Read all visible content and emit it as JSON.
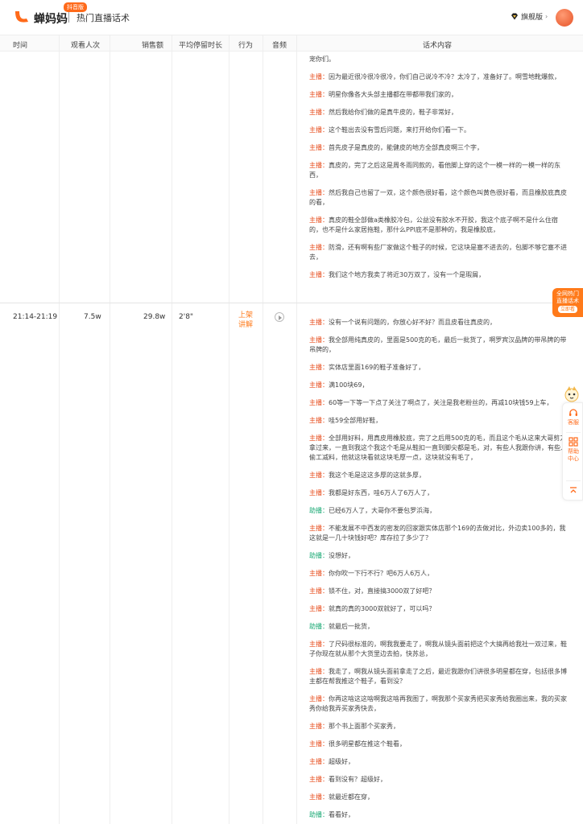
{
  "header": {
    "brand": "蝉妈妈",
    "badge": "抖音版",
    "product_title": "热门直播话术",
    "vip_label": "旗舰版",
    "vip_arrow": "›"
  },
  "columns": [
    "时间",
    "观看人次",
    "销售额",
    "平均停留时长",
    "行为",
    "音频",
    "话术内容"
  ],
  "speakers": {
    "host": "主播：",
    "assistant": "助播："
  },
  "colors": {
    "brand": "#ff6a1a",
    "host": "#e74c1c",
    "assistant": "#19a974"
  },
  "rows": [
    {
      "time": "",
      "viewers": "",
      "sales": "",
      "avg_stay": "",
      "action": "",
      "lines": [
        {
          "speaker": "",
          "text": "宠你们。"
        },
        {
          "speaker": "host",
          "text": "因为最近很冷很冷很冷，你们自己说冷不冷？太冷了，准备好了。啊雪地靴爆款，"
        },
        {
          "speaker": "host",
          "text": "明星你像各大头部主播都在带都带我们家的，"
        },
        {
          "speaker": "host",
          "text": "然后我给你们做的是真牛皮的，鞋子非常好，"
        },
        {
          "speaker": "host",
          "text": "这个鞋出去没有雪后问题，来打开给你们看一下。"
        },
        {
          "speaker": "host",
          "text": "首先皮子是真皮的，能健皮的地方全部真皮啊三个字，"
        },
        {
          "speaker": "host",
          "text": "真皮的，完了之后这是周冬雨同款的，看他脚上穿的这个一模一样的一模一样的东西，"
        },
        {
          "speaker": "host",
          "text": "然后我自己也留了一双，这个颜色很好看，这个颜色叫黄色很好看，而且橡胶底真皮的看，"
        },
        {
          "speaker": "host",
          "text": "真皮的鞋全部做a类橡胶冷包，公益没有胶水不开胶，我这个底子啊不是什么住宿的，也不是什么家居拖鞋，那什么PPI底不是那种的，我是橡胶底，"
        },
        {
          "speaker": "host",
          "text": "防滑，还有啊有些厂家做这个鞋子的时候，它这块是塞不进去的，包脚不够它塞不进去，"
        },
        {
          "speaker": "host",
          "text": "我们这个地方我卖了将近30万双了，没有一个是瑕屑，"
        }
      ]
    },
    {
      "time": "21:14-21:19",
      "viewers": "7.5w",
      "sales": "29.8w",
      "avg_stay": "2'8\"",
      "action": "上架讲解",
      "lines": [
        {
          "speaker": "host",
          "text": "没有一个说有问题的，你放心好不好？而且皮看往真皮的，"
        },
        {
          "speaker": "host",
          "text": "我全部用纯真皮的，里面是500克的毛，最后一批货了，啊罗宾汉品牌的带吊牌的带吊牌的，"
        },
        {
          "speaker": "host",
          "text": "实体店里面169的鞋子准备好了，"
        },
        {
          "speaker": "host",
          "text": "满100块69，"
        },
        {
          "speaker": "host",
          "text": "60等一下等一下点了关注了啊点了，关注是我老粉丝的，再减10块钱59上车，"
        },
        {
          "speaker": "host",
          "text": "哇59全部用好鞋，"
        },
        {
          "speaker": "host",
          "text": "全部用好料，用真皮用橡胶底，完了之后用500克的毛，而且这个毛从这来大哥剪刀拿过来，一直到我这个我这个毛是从鞋扣一直到脚尖都是毛，对，有些人我跟你讲，有些人偷工减料，他就这块看就这块毛厚一点，这块就没有毛了，"
        },
        {
          "speaker": "host",
          "text": "我这个毛是这这多厚的这就多厚，"
        },
        {
          "speaker": "host",
          "text": "我都是好东西，哇6万人了6万人了，"
        },
        {
          "speaker": "assistant",
          "text": "已经6万人了，大哥你不要包罗浜海，"
        },
        {
          "speaker": "host",
          "text": "不能发展不中西发的密发的回家跟实体店那个169的去做对比，外边卖100多的，我这就是一几十块钱好吧？库存拉了多少了？"
        },
        {
          "speaker": "assistant",
          "text": "没想好，"
        },
        {
          "speaker": "host",
          "text": "你你吹一下行不行？吧6万人6万人，"
        },
        {
          "speaker": "host",
          "text": "锁不住，对，直接搞3000双了好吧？"
        },
        {
          "speaker": "host",
          "text": "就真的真的3000双就好了，可以吗？"
        },
        {
          "speaker": "assistant",
          "text": "就最后一批货，"
        },
        {
          "speaker": "host",
          "text": "了尺码很标准的，啊我我要走了，啊我从镜头面前把这个大搞再给我社一双过来，鞋子你现在就从那个大货里边去拍，快苏总，"
        },
        {
          "speaker": "host",
          "text": "我走了，啊我从镜头面前拿走了之后，最近我跟你们讲很多明星都在穿，包括很多博主都在帮我推这个鞋子，看到没？"
        },
        {
          "speaker": "host",
          "text": "你再这啥这这啥啊我这啥再我图了，啊我那个买家秀把买家秀给我圈出来，我的买家秀你给我弄买家秀快去，"
        },
        {
          "speaker": "host",
          "text": "那个书上面那个买家秀，"
        },
        {
          "speaker": "host",
          "text": "很多明星都在推这个鞋看，"
        },
        {
          "speaker": "host",
          "text": "超级好，"
        },
        {
          "speaker": "host",
          "text": "看到没有？超级好，"
        },
        {
          "speaker": "host",
          "text": "就最近都在穿，"
        },
        {
          "speaker": "assistant",
          "text": "看看好，"
        }
      ]
    }
  ],
  "promo": {
    "line1": "全网热门",
    "line2": "直播话术",
    "cta": "立即看"
  },
  "side_panel": {
    "service": "客服",
    "help": "帮助中心"
  }
}
